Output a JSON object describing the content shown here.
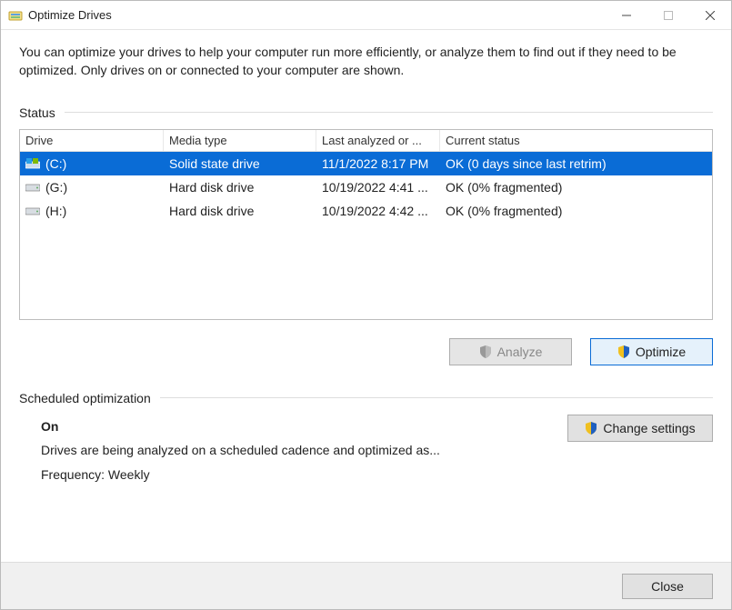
{
  "window": {
    "title": "Optimize Drives"
  },
  "intro": "You can optimize your drives to help your computer run more efficiently, or analyze them to find out if they need to be optimized. Only drives on or connected to your computer are shown.",
  "sections": {
    "status_label": "Status",
    "sched_label": "Scheduled optimization"
  },
  "columns": {
    "drive": "Drive",
    "media": "Media type",
    "last": "Last analyzed or ...",
    "status": "Current status"
  },
  "drives": [
    {
      "name": "(C:)",
      "media": "Solid state drive",
      "last": "11/1/2022 8:17 PM",
      "status": "OK (0 days since last retrim)",
      "selected": true,
      "icon": "os"
    },
    {
      "name": "(G:)",
      "media": "Hard disk drive",
      "last": "10/19/2022 4:41 ...",
      "status": "OK (0% fragmented)",
      "selected": false,
      "icon": "hdd"
    },
    {
      "name": "(H:)",
      "media": "Hard disk drive",
      "last": "10/19/2022 4:42 ...",
      "status": "OK (0% fragmented)",
      "selected": false,
      "icon": "hdd"
    }
  ],
  "buttons": {
    "analyze": "Analyze",
    "optimize": "Optimize",
    "change": "Change settings",
    "close": "Close"
  },
  "scheduled": {
    "state": "On",
    "desc": "Drives are being analyzed on a scheduled cadence and optimized as...",
    "freq_label": "Frequency: Weekly"
  }
}
